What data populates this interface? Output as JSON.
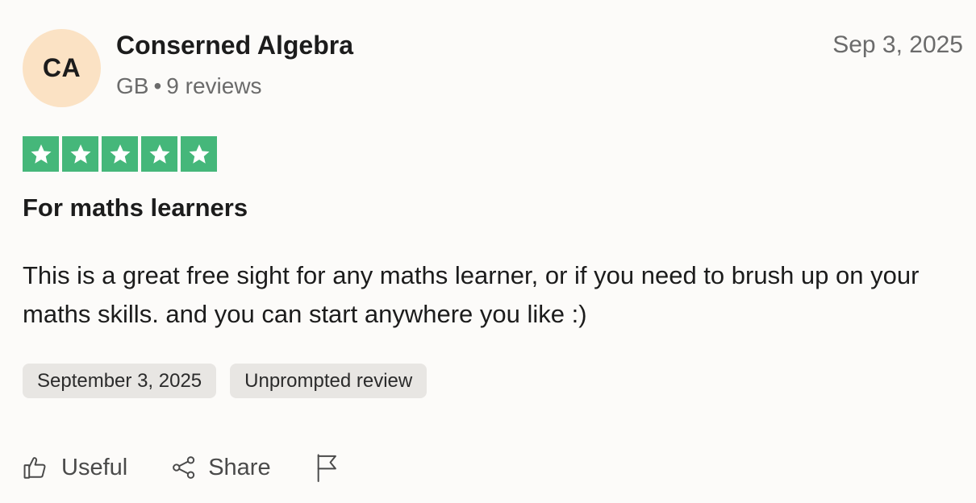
{
  "reviewer": {
    "initials": "CA",
    "name": "Conserned Algebra",
    "country": "GB",
    "separator": "•",
    "review_count": "9 reviews",
    "avatar_color": "#fbe2c4"
  },
  "review": {
    "date_short": "Sep 3, 2025",
    "rating": 5,
    "rating_max": 5,
    "star_color": "#45b77a",
    "title": "For maths learners",
    "body": "This is a great free sight for any maths learner, or if you need to brush up on your maths skills. and you can start anywhere you like :)",
    "tags": [
      "September 3, 2025",
      "Unprompted review"
    ]
  },
  "actions": {
    "useful_label": "Useful",
    "useful_icon": "thumbs-up-icon",
    "share_label": "Share",
    "share_icon": "share-icon",
    "report_icon": "flag-icon"
  }
}
